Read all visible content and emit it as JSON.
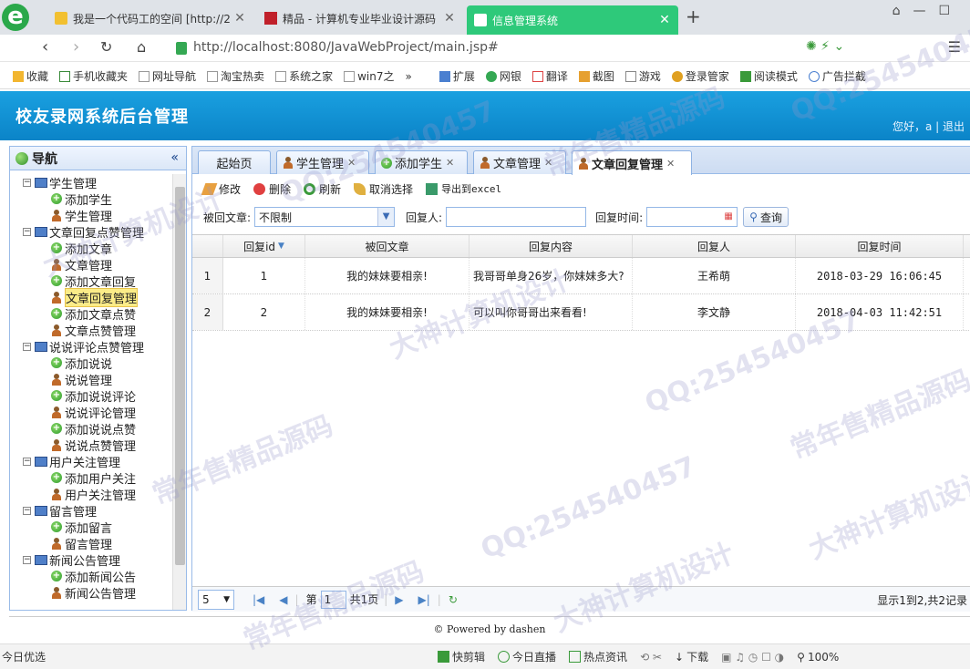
{
  "browser": {
    "tabs": [
      {
        "title": "我是一个代码工的空间 [http://2"
      },
      {
        "title": "精品 - 计算机专业毕业设计源码"
      },
      {
        "title": "信息管理系统"
      }
    ],
    "new_tab": "+",
    "url": "http://localhost:8080/JavaWebProject/main.jsp#",
    "bookmarks": [
      "收藏",
      "手机收藏夹",
      "网址导航",
      "淘宝热卖",
      "系统之家",
      "win7之",
      "扩展",
      "网银",
      "翻译",
      "截图",
      "游戏",
      "登录管家",
      "阅读模式",
      "广告拦截"
    ]
  },
  "app": {
    "title": "校友录网系统后台管理",
    "greeting": "您好，a | 退出"
  },
  "nav": {
    "title": "导航",
    "collapse": "«",
    "groups": [
      {
        "label": "学生管理",
        "items": [
          "添加学生",
          "学生管理"
        ]
      },
      {
        "label": "文章回复点赞管理",
        "items": [
          "添加文章",
          "文章管理",
          "添加文章回复",
          "文章回复管理",
          "添加文章点赞",
          "文章点赞管理"
        ]
      },
      {
        "label": "说说评论点赞管理",
        "items": [
          "添加说说",
          "说说管理",
          "添加说说评论",
          "说说评论管理",
          "添加说说点赞",
          "说说点赞管理"
        ]
      },
      {
        "label": "用户关注管理",
        "items": [
          "添加用户关注",
          "用户关注管理"
        ]
      },
      {
        "label": "留言管理",
        "items": [
          "添加留言",
          "留言管理"
        ]
      },
      {
        "label": "新闻公告管理",
        "items": [
          "添加新闻公告",
          "新闻公告管理"
        ]
      }
    ],
    "selected": "文章回复管理"
  },
  "panel": {
    "tabs": [
      "起始页",
      "学生管理",
      "添加学生",
      "文章管理",
      "文章回复管理"
    ],
    "active_tab": "文章回复管理",
    "toolbar": {
      "edit": "修改",
      "delete": "删除",
      "refresh": "刷新",
      "cancel_select": "取消选择",
      "export": "导出到excel"
    },
    "filter": {
      "article_label": "被回文章:",
      "article_value": "不限制",
      "replier_label": "回复人:",
      "time_label": "回复时间:",
      "query": "查询"
    },
    "grid": {
      "columns": [
        "回复id",
        "被回文章",
        "回复内容",
        "回复人",
        "回复时间"
      ],
      "rows": [
        {
          "rownum": "1",
          "id": "1",
          "article": "我的妹妹要相亲!",
          "content": "我哥哥单身26岁，你妹妹多大?",
          "replier": "王希萌",
          "time": "2018-03-29 16:06:45"
        },
        {
          "rownum": "2",
          "id": "2",
          "article": "我的妹妹要相亲!",
          "content": "可以叫你哥哥出来看看!",
          "replier": "李文静",
          "time": "2018-04-03 11:42:51"
        }
      ]
    },
    "pager": {
      "page_size": "5",
      "page_prefix": "第",
      "page_value": "1",
      "page_suffix": "共1页",
      "info": "显示1到2,共2记录"
    }
  },
  "footer": "© Powered by dashen",
  "statusbar": {
    "left": "今日优选",
    "items": [
      "快剪辑",
      "今日直播",
      "热点资讯",
      "下载",
      "100%"
    ]
  },
  "watermarks": [
    "QQ:254540457",
    "常年售精品源码",
    "大神计算机设计"
  ]
}
